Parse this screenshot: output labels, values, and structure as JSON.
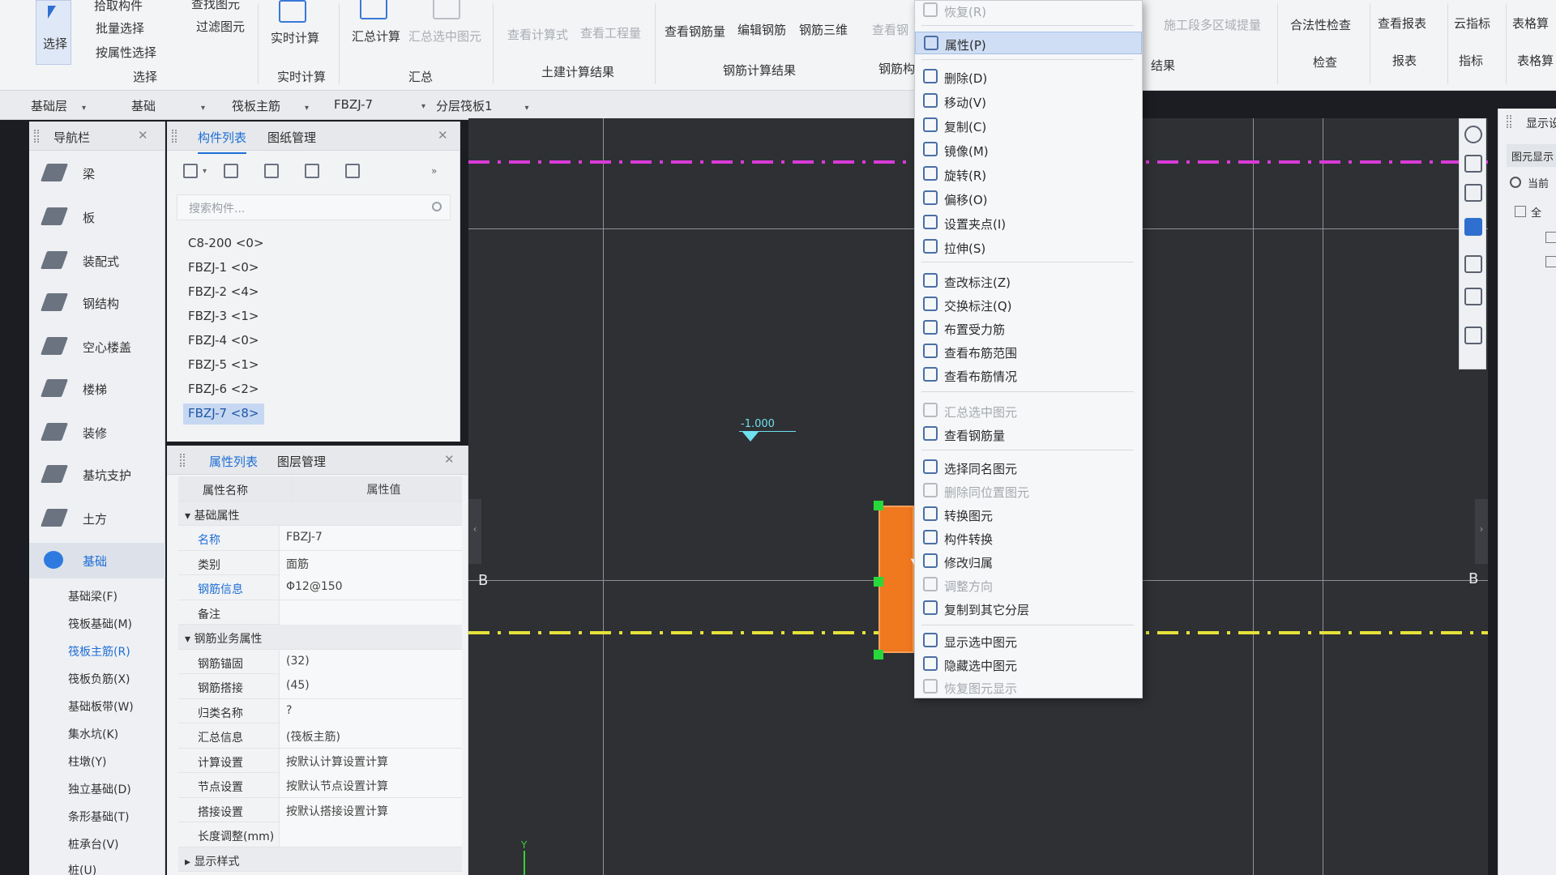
{
  "ribbon": {
    "select": {
      "label": "选择",
      "group": "选择",
      "pick": "拾取构件",
      "batch": "批量选择",
      "by_attr": "按属性选择",
      "find": "查找图元",
      "filter": "过滤图元"
    },
    "realtime": {
      "label": "实时计算",
      "group": "实时计算"
    },
    "summary": {
      "total": "汇总计算",
      "selected": "汇总选中图元",
      "group": "汇总"
    },
    "civil": {
      "view_formula": "查看计算式",
      "view_qty": "查看工程量",
      "group": "土建计算结果"
    },
    "rebar": {
      "view": "查看钢筋量",
      "edit": "编辑钢筋",
      "three_d": "钢筋三维",
      "group": "钢筋计算结果"
    },
    "rebar2": {
      "view_short": "查看钢",
      "group": "钢筋构"
    },
    "construction": {
      "partial": "施工段多区域提量",
      "group": "结果"
    },
    "check": {
      "label": "合法性检查",
      "group": "检查"
    },
    "report": {
      "label": "查看报表",
      "group": "报表"
    },
    "index": {
      "label": "云指标",
      "group": "指标"
    },
    "table": {
      "label": "表格算",
      "group": "表格算"
    }
  },
  "layerbar": {
    "floor": "基础层",
    "category": "基础",
    "type": "筏板主筋",
    "component": "FBZJ-7",
    "sublayer": "分层筏板1"
  },
  "nav": {
    "title": "导航栏",
    "items": [
      "梁",
      "板",
      "装配式",
      "钢结构",
      "空心楼盖",
      "楼梯",
      "装修",
      "基坑支护",
      "土方",
      "基础"
    ],
    "sub_items": [
      "基础梁(F)",
      "筏板基础(M)",
      "筏板主筋(R)",
      "筏板负筋(X)",
      "基础板带(W)",
      "集水坑(K)",
      "柱墩(Y)",
      "独立基础(D)",
      "条形基础(T)",
      "桩承台(V)",
      "桩(U)"
    ]
  },
  "complist": {
    "tabs": [
      "构件列表",
      "图纸管理"
    ],
    "search_placeholder": "搜索构件...",
    "items": [
      "C8-200 <0>",
      "FBZJ-1 <0>",
      "FBZJ-2 <4>",
      "FBZJ-3 <1>",
      "FBZJ-4 <0>",
      "FBZJ-5 <1>",
      "FBZJ-6 <2>",
      "FBZJ-7 <8>"
    ]
  },
  "props": {
    "tabs": [
      "属性列表",
      "图层管理"
    ],
    "col_name": "属性名称",
    "col_value": "属性值",
    "group1": "基础属性",
    "name_k": "名称",
    "name_v": "FBZJ-7",
    "type_k": "类别",
    "type_v": "面筋",
    "rebar_k": "钢筋信息",
    "rebar_v": "Φ12@150",
    "note_k": "备注",
    "note_v": "",
    "group2": "钢筋业务属性",
    "anchor_k": "钢筋锚固",
    "anchor_v": "(32)",
    "lap_k": "钢筋搭接",
    "lap_v": "(45)",
    "class_k": "归类名称",
    "class_v": "?",
    "sum_k": "汇总信息",
    "sum_v": "(筏板主筋)",
    "calc_k": "计算设置",
    "calc_v": "按默认计算设置计算",
    "node_k": "节点设置",
    "node_v": "按默认节点设置计算",
    "lapset_k": "搭接设置",
    "lapset_v": "按默认搭接设置计算",
    "len_k": "长度调整(mm)",
    "len_v": "",
    "group3": "显示样式"
  },
  "canvas": {
    "axis_left": "B",
    "axis_right": "B",
    "elevation": "-1.000",
    "ucs_y": "Y"
  },
  "rpanel": {
    "title": "显示设",
    "row1": "图元显示",
    "row2": "当前",
    "row3": "全"
  },
  "menu": {
    "items": [
      {
        "label": "恢复(R)",
        "disabled": true
      },
      {
        "label": "属性(P)",
        "highlight": true
      },
      {
        "label": "删除(D)"
      },
      {
        "label": "移动(V)"
      },
      {
        "label": "复制(C)"
      },
      {
        "label": "镜像(M)"
      },
      {
        "label": "旋转(R)"
      },
      {
        "label": "偏移(O)"
      },
      {
        "label": "设置夹点(I)"
      },
      {
        "label": "拉伸(S)"
      },
      {
        "label": "查改标注(Z)"
      },
      {
        "label": "交换标注(Q)"
      },
      {
        "label": "布置受力筋"
      },
      {
        "label": "查看布筋范围"
      },
      {
        "label": "查看布筋情况"
      },
      {
        "label": "汇总选中图元",
        "disabled": true
      },
      {
        "label": "查看钢筋量"
      },
      {
        "label": "选择同名图元"
      },
      {
        "label": "删除同位置图元",
        "disabled": true
      },
      {
        "label": "转换图元"
      },
      {
        "label": "构件转换"
      },
      {
        "label": "修改归属"
      },
      {
        "label": "调整方向",
        "disabled": true
      },
      {
        "label": "复制到其它分层"
      },
      {
        "label": "显示选中图元"
      },
      {
        "label": "隐藏选中图元"
      },
      {
        "label": "恢复图元显示",
        "disabled": true
      }
    ]
  },
  "colors": {
    "accent": "#1f6fd6",
    "slab": "#f0781f",
    "pink_axis": "#d93ad8",
    "yellow_axis": "#e6e23a",
    "handle": "#27d83a",
    "elevation": "#6fe0ee"
  }
}
